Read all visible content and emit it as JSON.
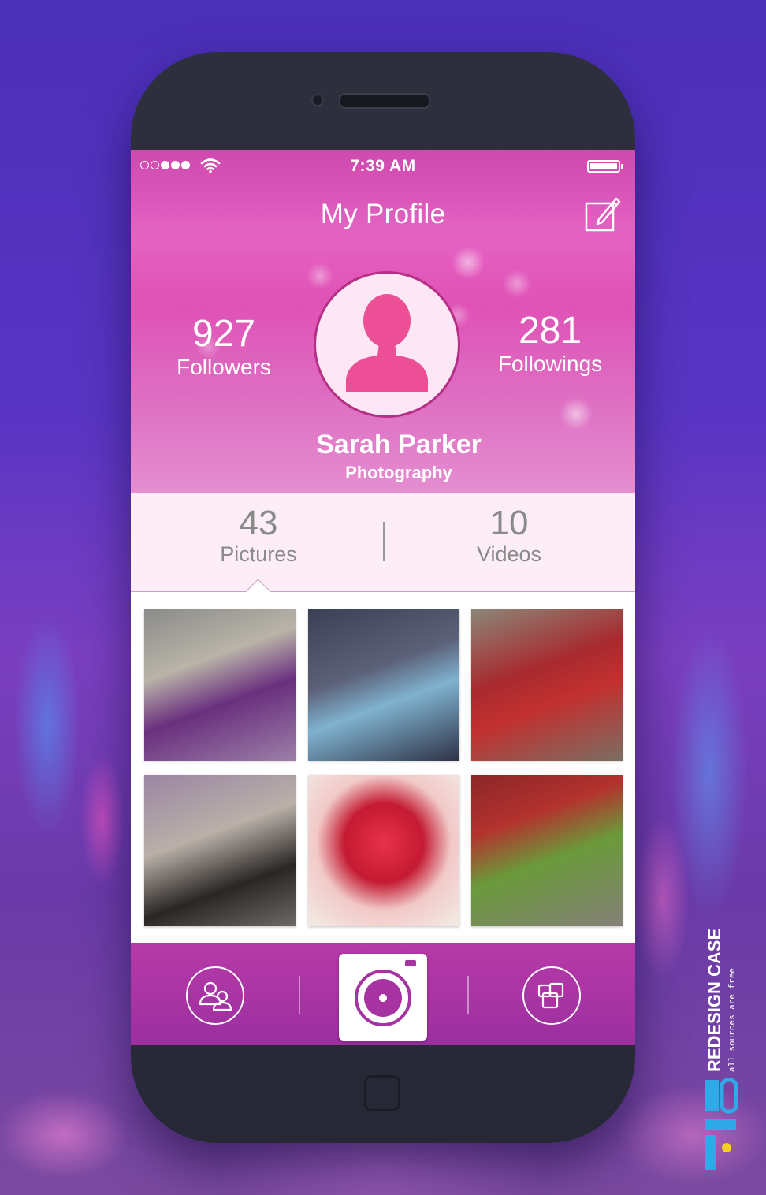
{
  "status_bar": {
    "time": "7:39 AM"
  },
  "header": {
    "title": "My Profile"
  },
  "profile": {
    "name": "Sarah Parker",
    "subtitle": "Photography",
    "followers": {
      "count": "927",
      "label": "Followers"
    },
    "followings": {
      "count": "281",
      "label": "Followings"
    }
  },
  "tabs": [
    {
      "count": "43",
      "label": "Pictures",
      "selected": true
    },
    {
      "count": "10",
      "label": "Videos",
      "selected": false
    }
  ],
  "gallery": {
    "photos": [
      {
        "subject": "woman in purple dress on street"
      },
      {
        "subject": "girl sitting with head on knees"
      },
      {
        "subject": "little girl in red coat with green bag"
      },
      {
        "subject": "woman in black boots"
      },
      {
        "subject": "red rose"
      },
      {
        "subject": "child walking with green bag"
      }
    ]
  },
  "tabbar": {
    "items": [
      {
        "icon": "friends-icon"
      },
      {
        "icon": "camera-icon"
      },
      {
        "icon": "gallery-icon"
      }
    ]
  },
  "watermark": {
    "brand": "REDESIGN CASE",
    "tagline": "all sources are free"
  },
  "colors": {
    "accent_pink": "#e05ab8",
    "avatar_pink": "#ec4f96",
    "tabbar_purple": "#a733a3",
    "background_purple": "#5a35c4"
  }
}
